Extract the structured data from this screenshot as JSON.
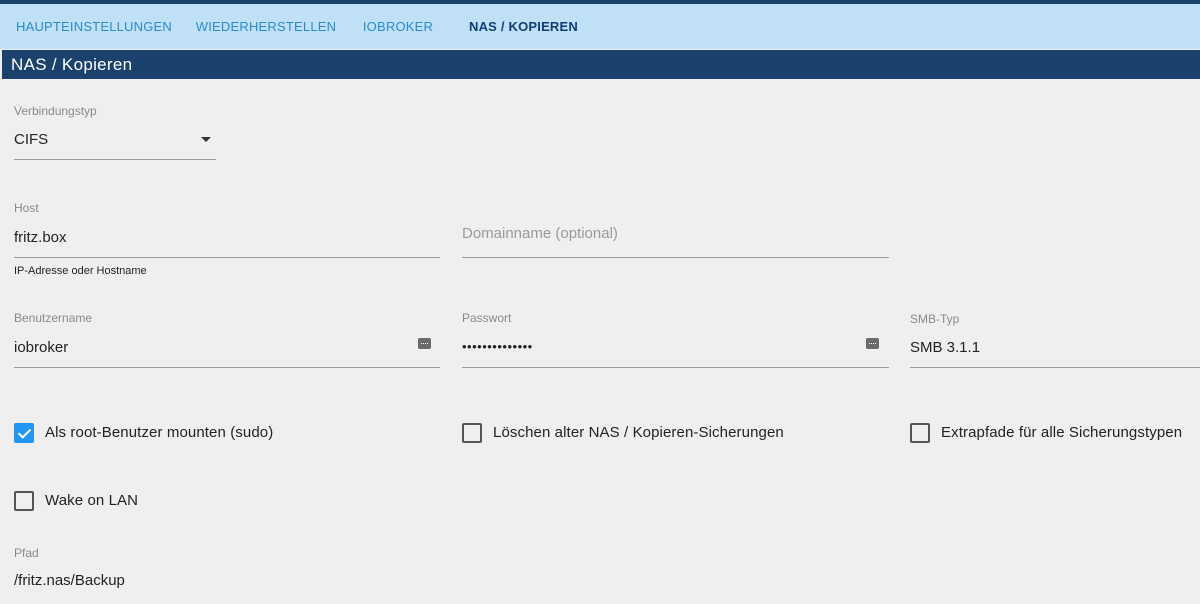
{
  "tabs": [
    {
      "label": "HAUPTEINSTELLUNGEN"
    },
    {
      "label": "WIEDERHERSTELLEN"
    },
    {
      "label": "IOBROKER"
    },
    {
      "label": "NAS / KOPIEREN"
    }
  ],
  "section_title": "NAS / Kopieren",
  "connection_type": {
    "label": "Verbindungstyp",
    "value": "CIFS"
  },
  "host": {
    "label": "Host",
    "value": "fritz.box",
    "helper": "IP-Adresse oder Hostname"
  },
  "domain": {
    "placeholder": "Domainname (optional)"
  },
  "username": {
    "label": "Benutzername",
    "value": "iobroker"
  },
  "password": {
    "label": "Passwort",
    "value": "••••••••••••••"
  },
  "smb_type": {
    "label": "SMB-Typ",
    "value": "SMB 3.1.1"
  },
  "checkboxes": {
    "root_mount": {
      "label": "Als root-Benutzer mounten (sudo)",
      "checked": true
    },
    "delete_old": {
      "label": "Löschen alter NAS / Kopieren-Sicherungen",
      "checked": false
    },
    "extra_paths": {
      "label": "Extrapfade für alle Sicherungstypen",
      "checked": false
    },
    "wake_on_lan": {
      "label": "Wake on LAN",
      "checked": false
    }
  },
  "path": {
    "label": "Pfad",
    "value": "/fritz.nas/Backup"
  },
  "colors": {
    "header_bg": "#1b416d",
    "tabbar_bg": "#bfe0f7",
    "tab_text": "#2a8bd2",
    "tab_active": "#0f3d78",
    "checkbox_checked": "#2196f3"
  },
  "icons": {
    "dropdown": "triangle-down",
    "password_toggle": "keyboard-dots"
  }
}
